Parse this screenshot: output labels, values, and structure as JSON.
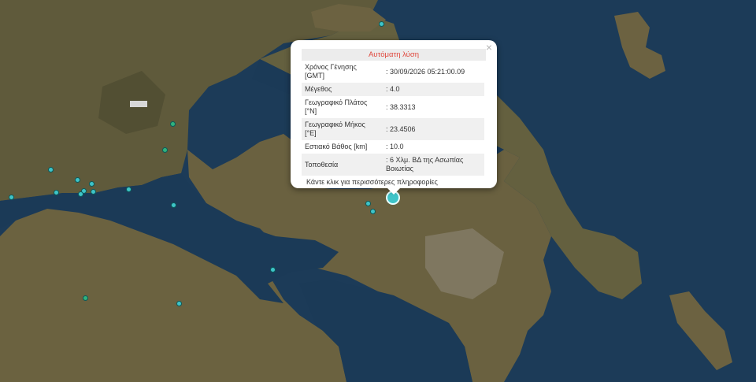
{
  "popup": {
    "title": "Αυτόματη λύση",
    "close_glyph": "×",
    "rows": [
      {
        "label": "Χρόνος Γένησης\n[GMT]",
        "value": ": 30/09/2026 05:21:00.09"
      },
      {
        "label": "Μέγεθος",
        "value": ": 4.0"
      },
      {
        "label": "Γεωγραφικό Πλάτος\n[°N]",
        "value": ": 38.3313"
      },
      {
        "label": "Γεωγραφικό Μήκος\n[°E]",
        "value": ": 23.4506"
      },
      {
        "label": "Εστιακό Βάθος [km]",
        "value": ": 10.0"
      },
      {
        "label": "Τοποθεσία",
        "value": ": 6 Χλμ. ΒΔ της Ασωπίας\nΒοιωτίας"
      }
    ],
    "more_link": "Κάντε κλικ για περισσότερες πληροφορίες"
  },
  "colors": {
    "sea": "#1b3a57",
    "land": "#6b6040",
    "marker_cyan": "#3fc4c8",
    "marker_green": "#2fb37d",
    "popup_title": "#e0463b"
  },
  "markers": {
    "main_event": {
      "lat": 38.3313,
      "lon": 23.4506,
      "magnitude": 4.0
    },
    "other_events": "small cyan and green earthquake markers"
  }
}
